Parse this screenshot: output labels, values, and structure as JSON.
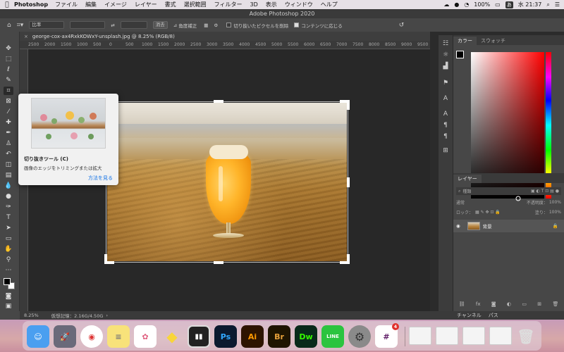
{
  "menubar": {
    "app_name": "Photoshop",
    "items": [
      "ファイル",
      "編集",
      "イメージ",
      "レイヤー",
      "書式",
      "選択範囲",
      "フィルター",
      "3D",
      "表示",
      "ウィンドウ",
      "ヘルプ"
    ],
    "battery": "100%",
    "input": "あ",
    "clock": "水 21:37"
  },
  "titlebar": {
    "title": "Adobe Photoshop 2020"
  },
  "options": {
    "ratio_select": "比率",
    "clear_button": "消去",
    "straighten_label": "角度補正",
    "delete_cropped_label": "切り抜いたピクセルを削除",
    "content_aware_label": "コンテンツに応じる",
    "content_aware_checked": true,
    "delete_cropped_checked": false
  },
  "document": {
    "tab_title": "george-cox-ax4RxkKOWxY-unsplash.jpg @ 8.25% (RGB/8)",
    "ruler_ticks": [
      "2500",
      "2000",
      "1500",
      "1000",
      "500",
      "0",
      "500",
      "1000",
      "1500",
      "2000",
      "2500",
      "3000",
      "3500",
      "4000",
      "4500",
      "5000",
      "5500",
      "6000",
      "6500",
      "7000",
      "7500",
      "8000",
      "8500",
      "9000",
      "9500"
    ]
  },
  "tooltip": {
    "title": "切り抜きツール (C)",
    "description": "画像のエッジをトリミングまたは拡大",
    "link": "方法を見る"
  },
  "color_panel": {
    "tabs": [
      "カラー",
      "スウォッチ"
    ],
    "foreground": "#000000",
    "background": "#ffffff"
  },
  "layers_panel": {
    "tab": "レイヤー",
    "filter_placeholder": "種類",
    "blend_mode": "通常",
    "opacity_label": "不透明度：",
    "opacity_value": "100%",
    "lock_label": "ロック：",
    "fill_label": "塗り：",
    "fill_value": "100%",
    "layer_name": "背景"
  },
  "status": {
    "zoom": "8.25%",
    "memory": "仮想記憶：2.16G/4.50G"
  },
  "bottom_tabs": [
    "チャンネル",
    "パス"
  ],
  "dock": {
    "apps": [
      {
        "name": "Finder",
        "glyph": "☺",
        "color": "#3a8ee6"
      },
      {
        "name": "Launchpad",
        "glyph": "🚀",
        "color": "#555"
      },
      {
        "name": "Chrome",
        "glyph": "◉",
        "color": "#ffffff"
      },
      {
        "name": "Notes",
        "glyph": "≡",
        "color": "#f8e27a"
      },
      {
        "name": "Photos",
        "glyph": "✿",
        "color": "#ffffff"
      },
      {
        "name": "Cyberduck",
        "glyph": "🦆",
        "color": "#f8d53a"
      },
      {
        "name": "Parallels",
        "glyph": "▮▮",
        "color": "#222"
      },
      {
        "name": "Ps",
        "glyph": "Ps",
        "color": "#0b1a2f"
      },
      {
        "name": "Ai",
        "glyph": "Ai",
        "color": "#2d1400"
      },
      {
        "name": "Br",
        "glyph": "Br",
        "color": "#1e1400"
      },
      {
        "name": "Dw",
        "glyph": "Dw",
        "color": "#082a1a"
      },
      {
        "name": "LINE",
        "glyph": "LINE",
        "color": "#2bc43f"
      },
      {
        "name": "System Preferences",
        "glyph": "⚙",
        "color": "#8a8a8a"
      },
      {
        "name": "Slack",
        "glyph": "#",
        "color": "#ffffff"
      }
    ],
    "slack_badge": "4"
  }
}
